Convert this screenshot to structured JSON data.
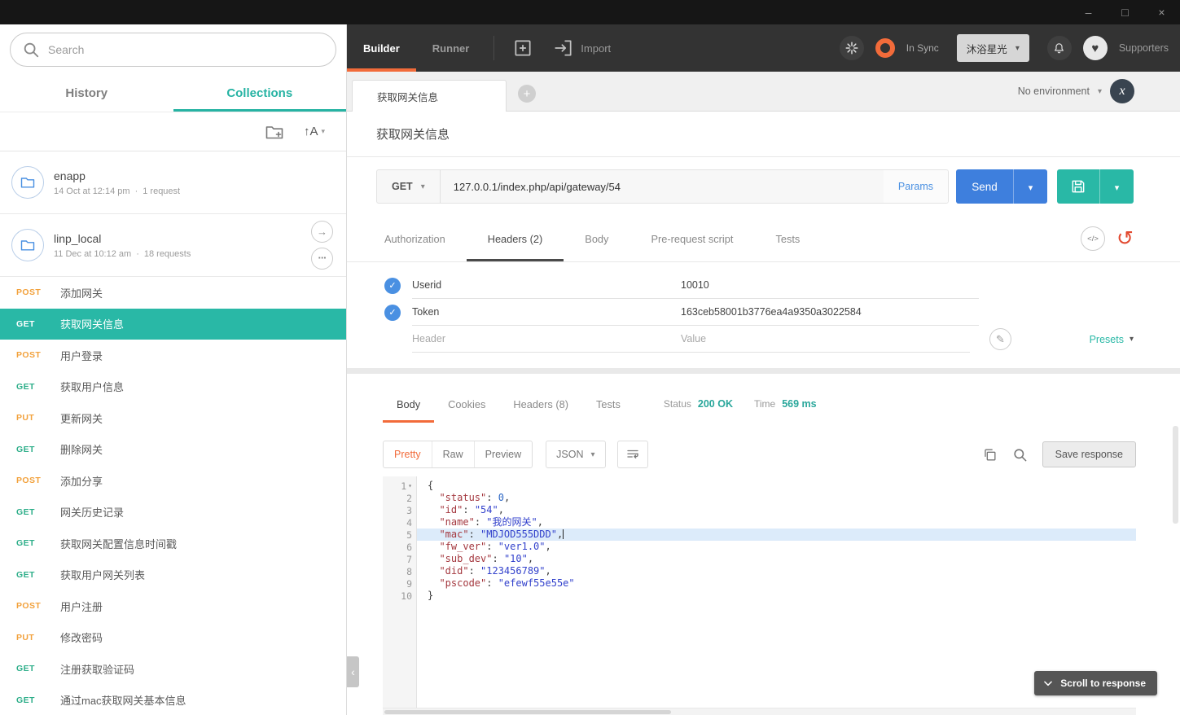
{
  "icons": {
    "minimize": "–",
    "maximize": "□",
    "close": "×",
    "chevron": "▾",
    "sort": "↑A",
    "plus": "+",
    "arrow_right": "→",
    "ellipsis": "···",
    "dot": "·",
    "check": "✓",
    "code": "</>",
    "undo": "↺",
    "pencil": "✎",
    "heart": "♥",
    "env_x": "x",
    "collapse": "‹"
  },
  "sidebar": {
    "search": {
      "placeholder": "Search"
    },
    "tabs": {
      "history": "History",
      "collections": "Collections"
    },
    "collections": [
      {
        "name": "enapp",
        "date": "14 Oct at 12:14 pm",
        "count": "1 request"
      },
      {
        "name": "linp_local",
        "date": "11 Dec at 10:12 am",
        "count": "18 requests"
      }
    ],
    "requests": [
      {
        "method": "POST",
        "name": "添加网关"
      },
      {
        "method": "GET",
        "name": "获取网关信息",
        "selected": true
      },
      {
        "method": "POST",
        "name": "用户登录"
      },
      {
        "method": "GET",
        "name": "获取用户信息"
      },
      {
        "method": "PUT",
        "name": "更新网关"
      },
      {
        "method": "GET",
        "name": "删除网关"
      },
      {
        "method": "POST",
        "name": "添加分享"
      },
      {
        "method": "GET",
        "name": "网关历史记录"
      },
      {
        "method": "GET",
        "name": "获取网关配置信息时间戳"
      },
      {
        "method": "GET",
        "name": "获取用户网关列表"
      },
      {
        "method": "POST",
        "name": "用户注册"
      },
      {
        "method": "PUT",
        "name": "修改密码"
      },
      {
        "method": "GET",
        "name": "注册获取验证码"
      },
      {
        "method": "GET",
        "name": "通过mac获取网关基本信息"
      }
    ]
  },
  "topbar": {
    "builder": "Builder",
    "runner": "Runner",
    "import": "Import",
    "in_sync": "In Sync",
    "account": "沐浴星光",
    "supporters": "Supporters"
  },
  "tabstrip": {
    "active_tab": "获取网关信息",
    "environment": "No environment"
  },
  "request": {
    "title": "获取网关信息",
    "method": "GET",
    "url": "127.0.0.1/index.php/api/gateway/54",
    "params": "Params",
    "send": "Send",
    "tabs": [
      {
        "label": "Authorization"
      },
      {
        "label": "Headers (2)"
      },
      {
        "label": "Body"
      },
      {
        "label": "Pre-request script"
      },
      {
        "label": "Tests"
      }
    ],
    "headers": [
      {
        "key": "Userid",
        "value": "10010"
      },
      {
        "key": "Token",
        "value": "163ceb58001b3776ea4a9350a3022584"
      }
    ],
    "placeholders": {
      "key": "Header",
      "value": "Value"
    },
    "presets": "Presets"
  },
  "response": {
    "tabs": [
      {
        "label": "Body"
      },
      {
        "label": "Cookies"
      },
      {
        "label": "Headers (8)"
      },
      {
        "label": "Tests"
      }
    ],
    "status_label": "Status",
    "status": "200 OK",
    "time_label": "Time",
    "time": "569 ms",
    "views": [
      {
        "label": "Pretty"
      },
      {
        "label": "Raw"
      },
      {
        "label": "Preview"
      }
    ],
    "format": "JSON",
    "save_response": "Save response",
    "scroll_to_response": "Scroll to response",
    "body_lines": [
      {
        "n": 1,
        "fold": true,
        "tokens": [
          [
            "pun",
            "{"
          ]
        ]
      },
      {
        "n": 2,
        "tokens": [
          [
            "pun",
            "  "
          ],
          [
            "key",
            "\"status\""
          ],
          [
            "pun",
            ": "
          ],
          [
            "num",
            "0"
          ],
          [
            "pun",
            ","
          ]
        ]
      },
      {
        "n": 3,
        "tokens": [
          [
            "pun",
            "  "
          ],
          [
            "key",
            "\"id\""
          ],
          [
            "pun",
            ": "
          ],
          [
            "str",
            "\"54\""
          ],
          [
            "pun",
            ","
          ]
        ]
      },
      {
        "n": 4,
        "tokens": [
          [
            "pun",
            "  "
          ],
          [
            "key",
            "\"name\""
          ],
          [
            "pun",
            ": "
          ],
          [
            "str",
            "\"我的网关\""
          ],
          [
            "pun",
            ","
          ]
        ]
      },
      {
        "n": 5,
        "highlight": true,
        "cursor": true,
        "tokens": [
          [
            "pun",
            "  "
          ],
          [
            "key",
            "\"mac\""
          ],
          [
            "pun",
            ": "
          ],
          [
            "str",
            "\"MDJOD555DDD\""
          ],
          [
            "pun",
            ","
          ]
        ]
      },
      {
        "n": 6,
        "tokens": [
          [
            "pun",
            "  "
          ],
          [
            "key",
            "\"fw_ver\""
          ],
          [
            "pun",
            ": "
          ],
          [
            "str",
            "\"ver1.0\""
          ],
          [
            "pun",
            ","
          ]
        ]
      },
      {
        "n": 7,
        "tokens": [
          [
            "pun",
            "  "
          ],
          [
            "key",
            "\"sub_dev\""
          ],
          [
            "pun",
            ": "
          ],
          [
            "str",
            "\"10\""
          ],
          [
            "pun",
            ","
          ]
        ]
      },
      {
        "n": 8,
        "tokens": [
          [
            "pun",
            "  "
          ],
          [
            "key",
            "\"did\""
          ],
          [
            "pun",
            ": "
          ],
          [
            "str",
            "\"123456789\""
          ],
          [
            "pun",
            ","
          ]
        ]
      },
      {
        "n": 9,
        "tokens": [
          [
            "pun",
            "  "
          ],
          [
            "key",
            "\"pscode\""
          ],
          [
            "pun",
            ": "
          ],
          [
            "str",
            "\"efewf55e55e\""
          ]
        ]
      },
      {
        "n": 10,
        "tokens": [
          [
            "pun",
            "}"
          ]
        ]
      }
    ]
  }
}
